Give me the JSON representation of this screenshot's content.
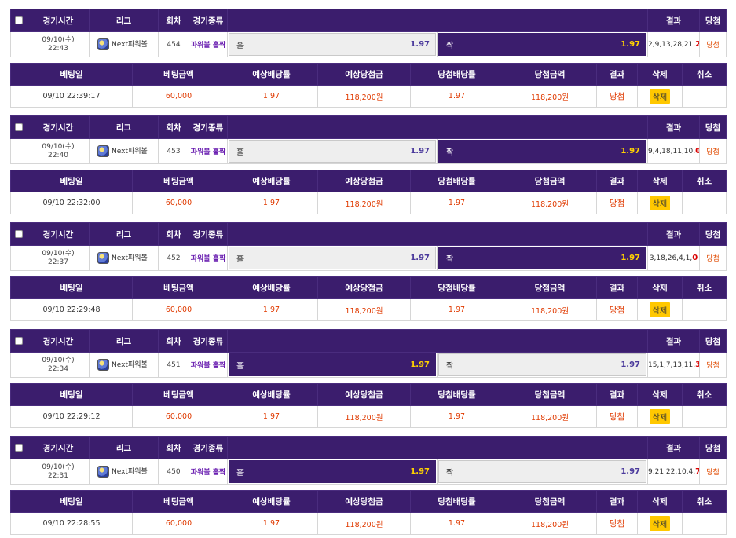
{
  "game_headers": {
    "time": "경기시간",
    "league": "리그",
    "round": "회차",
    "type": "경기종류",
    "result": "결과",
    "win": "당첨"
  },
  "bet_headers": {
    "bet_date": "베팅일",
    "bet_amount": "베팅금액",
    "expected_odds": "예상배당률",
    "expected_win": "예상당첨금",
    "win_odds": "당첨배당률",
    "win_amount": "당첨금액",
    "result": "결과",
    "delete": "삭제",
    "cancel": "취소"
  },
  "bets": [
    {
      "game": {
        "date": "09/10(수)",
        "time": "22:43",
        "league": "Next파워볼",
        "round": "454",
        "type": "파워볼 홀짝",
        "pick_left": {
          "label": "홀",
          "odds": "1.97"
        },
        "pick_right": {
          "label": "짝",
          "odds": "1.97"
        },
        "selected": "right",
        "result_prefix": "2,9,13,28,21,",
        "result_last": "2",
        "win": "당첨"
      },
      "bet": {
        "date": "09/10 22:39:17",
        "amount": "60,000",
        "expected_odds": "1.97",
        "expected_win": "118,200원",
        "win_odds": "1.97",
        "win_amount": "118,200원",
        "result": "당첨",
        "delete": "삭제"
      }
    },
    {
      "game": {
        "date": "09/10(수)",
        "time": "22:40",
        "league": "Next파워볼",
        "round": "453",
        "type": "파워볼 홀짝",
        "pick_left": {
          "label": "홀",
          "odds": "1.97"
        },
        "pick_right": {
          "label": "짝",
          "odds": "1.97"
        },
        "selected": "right",
        "result_prefix": "9,4,18,11,10,",
        "result_last": "0",
        "win": "당첨"
      },
      "bet": {
        "date": "09/10 22:32:00",
        "amount": "60,000",
        "expected_odds": "1.97",
        "expected_win": "118,200원",
        "win_odds": "1.97",
        "win_amount": "118,200원",
        "result": "당첨",
        "delete": "삭제"
      }
    },
    {
      "game": {
        "date": "09/10(수)",
        "time": "22:37",
        "league": "Next파워볼",
        "round": "452",
        "type": "파워볼 홀짝",
        "pick_left": {
          "label": "홀",
          "odds": "1.97"
        },
        "pick_right": {
          "label": "짝",
          "odds": "1.97"
        },
        "selected": "right",
        "result_prefix": "3,18,26,4,1,",
        "result_last": "0",
        "win": "당첨"
      },
      "bet": {
        "date": "09/10 22:29:48",
        "amount": "60,000",
        "expected_odds": "1.97",
        "expected_win": "118,200원",
        "win_odds": "1.97",
        "win_amount": "118,200원",
        "result": "당첨",
        "delete": "삭제"
      }
    },
    {
      "game": {
        "date": "09/10(수)",
        "time": "22:34",
        "league": "Next파워볼",
        "round": "451",
        "type": "파워볼 홀짝",
        "pick_left": {
          "label": "홀",
          "odds": "1.97"
        },
        "pick_right": {
          "label": "짝",
          "odds": "1.97"
        },
        "selected": "left",
        "result_prefix": "15,1,7,13,11,",
        "result_last": "3",
        "win": "당첨"
      },
      "bet": {
        "date": "09/10 22:29:12",
        "amount": "60,000",
        "expected_odds": "1.97",
        "expected_win": "118,200원",
        "win_odds": "1.97",
        "win_amount": "118,200원",
        "result": "당첨",
        "delete": "삭제"
      }
    },
    {
      "game": {
        "date": "09/10(수)",
        "time": "22:31",
        "league": "Next파워볼",
        "round": "450",
        "type": "파워볼 홀짝",
        "pick_left": {
          "label": "홀",
          "odds": "1.97"
        },
        "pick_right": {
          "label": "짝",
          "odds": "1.97"
        },
        "selected": "left",
        "result_prefix": "9,21,22,10,4,",
        "result_last": "7",
        "win": "당첨"
      },
      "bet": {
        "date": "09/10 22:28:55",
        "amount": "60,000",
        "expected_odds": "1.97",
        "expected_win": "118,200원",
        "win_odds": "1.97",
        "win_amount": "118,200원",
        "result": "당첨",
        "delete": "삭제"
      }
    }
  ],
  "colors": {
    "header_bg": "#3b1d6d",
    "selected_odds": "#ffd200",
    "normal_odds": "#4b3a9c",
    "result_last": "#d80000",
    "win_text": "#e03a00",
    "delete_button": "#ffc800"
  }
}
